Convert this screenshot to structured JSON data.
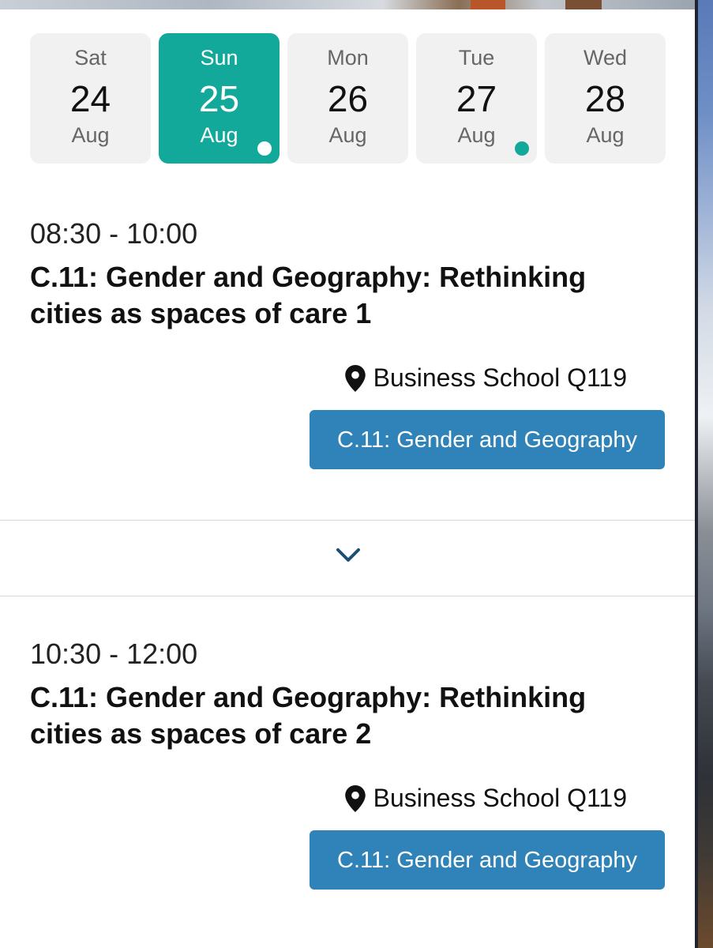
{
  "colors": {
    "accent": "#12a89a",
    "button": "#2f83b9",
    "tab_bg": "#f1f1f1",
    "chevron": "#1d4f73"
  },
  "dates": [
    {
      "dow": "Sat",
      "day": "24",
      "month": "Aug",
      "selected": false,
      "has_events": false
    },
    {
      "dow": "Sun",
      "day": "25",
      "month": "Aug",
      "selected": true,
      "has_events": true
    },
    {
      "dow": "Mon",
      "day": "26",
      "month": "Aug",
      "selected": false,
      "has_events": false
    },
    {
      "dow": "Tue",
      "day": "27",
      "month": "Aug",
      "selected": false,
      "has_events": true
    },
    {
      "dow": "Wed",
      "day": "28",
      "month": "Aug",
      "selected": false,
      "has_events": false
    }
  ],
  "sessions": [
    {
      "time": "08:30 - 10:00",
      "title": "C.11: Gender and Geography: Rethinking cities as spaces of care 1",
      "location": "Business School Q119",
      "track": "C.11: Gender and Geography"
    },
    {
      "time": "10:30 - 12:00",
      "title": "C.11: Gender and Geography: Rethinking cities as spaces of care 2",
      "location": "Business School Q119",
      "track": "C.11: Gender and Geography"
    }
  ],
  "icons": {
    "location": "map-pin-icon",
    "expand": "chevron-down-icon"
  }
}
